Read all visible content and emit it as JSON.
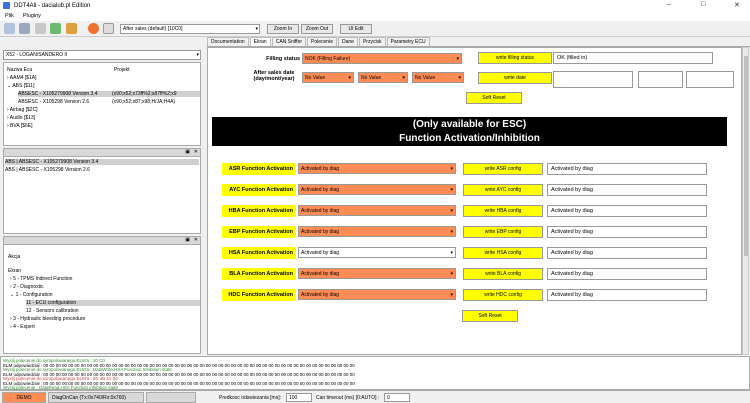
{
  "window": {
    "title": "DDT4All - dacialub.pl Edition"
  },
  "menu": [
    "Plik",
    "Pluginy"
  ],
  "toolbar": {
    "ecu_combo": "After sales (default) [10C0]",
    "zoom_in": "Zoom In",
    "zoom_out": "Zoom Out",
    "ui_edit": "UI Edit"
  },
  "vehicle": {
    "combo": "X52 - LOGAN/SANDERO II"
  },
  "ecu_list": {
    "headers": [
      "Nazwa Ecu",
      "Projekt"
    ],
    "rows": [
      {
        "name": "AAM4 [$1A]",
        "project": ""
      },
      {
        "name": "ABS [$11]",
        "project": ""
      },
      {
        "name": "ABSESC - X105279908 Version 3.4",
        "project": "(x90;x52;x73ff%2;x87ff%2;x9"
      },
      {
        "name": "ABSESC - X105298 Version 2.6",
        "project": "(x90;x52;x87;x98;H/JA;H4A)"
      },
      {
        "name": "Airbag [$2C]",
        "project": ""
      },
      {
        "name": "Audio [$13]",
        "project": ""
      },
      {
        "name": "BVA [$6E]",
        "project": ""
      }
    ]
  },
  "ecu_selected": [
    "ABS | ABSESC - X105279908 Version 3.4",
    "ABS | ABSESC - X105298 Version 2.6"
  ],
  "actions": {
    "title": "Akcja",
    "header": "Ekran",
    "items": [
      "5 - TPMS Indirect Function",
      "2 - Diagnostic",
      "1 - Configuration",
      "11 - ECU configuration",
      "12 - Sensors calibration",
      "3 - Hydraulic bleeding procedure",
      "4 - Expert"
    ]
  },
  "tabs": [
    "Documentation",
    "Ekran",
    "CAN Sniffer",
    "Polecenie",
    "Dane",
    "Przycisk",
    "Parametry ECU"
  ],
  "form": {
    "filling_label": "Filling status",
    "filling_value": "NOK (Filling Failure)",
    "write_filling": "write filling status",
    "filling_result": "OK (filled in)",
    "date_label1": "After sales date",
    "date_label2": "(day/mont/year)",
    "no_value": "No Value",
    "write_date": "write date",
    "soft_reset": "Soft Reset",
    "banner1": "(Only available for ESC)",
    "banner2": "Function Activation/Inhibition",
    "functions": [
      {
        "label": "ASR Function Activation",
        "value": "Activated by diag",
        "button": "write ASR config",
        "result": "Activated by diag"
      },
      {
        "label": "AYC Function Activation",
        "value": "Activated by diag",
        "button": "write AYC config",
        "result": "Activated by diag"
      },
      {
        "label": "HBA Function Activation",
        "value": "Activated by diag",
        "button": "write HBA config",
        "result": "Activated by diag"
      },
      {
        "label": "EBP Function Activation",
        "value": "Activated by diag",
        "button": "write EBP config",
        "result": "Activated by diag"
      },
      {
        "label": "HSA Function Activation",
        "value": "Activated by diag",
        "button": "write HSA config",
        "result": "Activated by diag"
      },
      {
        "label": "BLA Function Activation",
        "value": "Activated by diag",
        "button": "write BLA config",
        "result": "Activated by diag"
      },
      {
        "label": "HDC Function Activation",
        "value": "Activated by diag",
        "button": "write HDC config",
        "result": "Activated by diag"
      }
    ],
    "soft_reset2": "Soft Reset"
  },
  "log": [
    "Wyslij polecenie do sympolowanego ELM'a : 10 C0",
    "ELM odpowiedział : 00 00 00 00 00 00 00 00 00 00 00 00 00 00 00 00 00 00 00 00 00 00 00 00 00 00 00 00 00 00 00 00 00 00 00 00 00 00 00 00 00 00 00 00 00 00 00 00 00 00",
    "Wyslij polecenie do sympolowanego ELM'a : DataWrite.HSA Function Inhibition state",
    "ELM odpowiedział : 00 00 00 00 00 00 00 00 00 00 00 00 00 00 00 00 00 00 00 00 00 00 00 00 00 00 00 00 00 00 00 00 00 00 00 00 00 00 00 00 00 00 00 00 00 00 00 00 00 00",
    "Wyslij polecenie do sympolowanego ELM'a : 2E 4B 31 00",
    "ELM odpowiedział : 00 00 00 00 00 00 00 00 00 00 00 00 00 00 00 00 00 00 00 00 00 00 00 00 00 00 00 00 00 00 00 00 00 00 00 00 00 00 00 00 00 00 00 00 00 00 00 00 00 00",
    "Wyslij polecenie : DataRead.HSA Function inhibition state"
  ],
  "status": {
    "mode": "DEMO",
    "can": "DiagOnCan (Tx:0x740/Rx:0x760)",
    "speed_label": "Predkosc odswiezania [ms]:",
    "speed_value": "100",
    "timeout_label": "Can timeout (ms) [0:AUTO] :",
    "timeout_value": "0"
  },
  "colors": {
    "orange": "#ff8c55",
    "yellow": "#ffff00",
    "black": "#000000"
  }
}
